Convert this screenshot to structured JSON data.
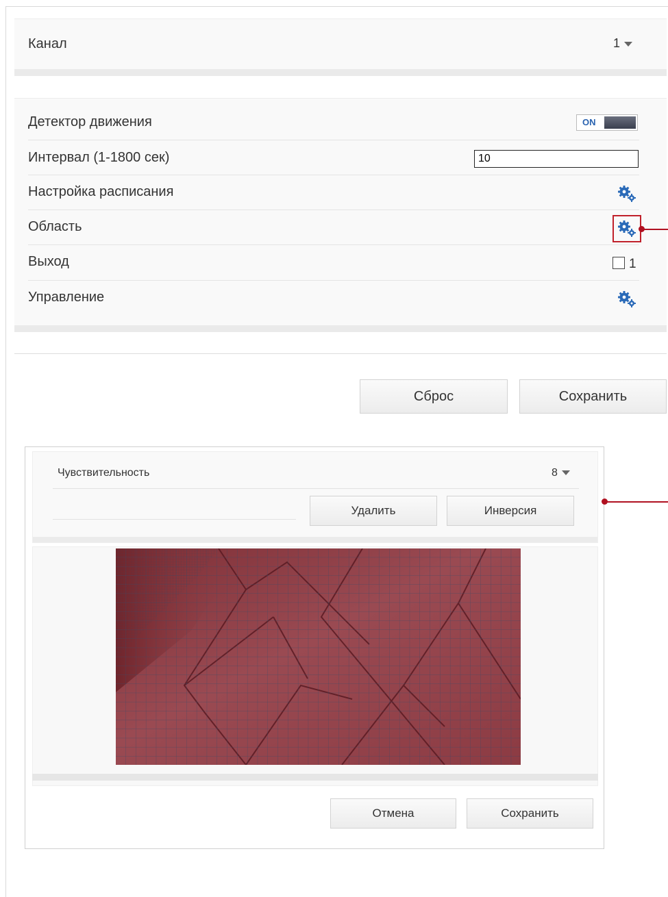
{
  "channel": {
    "label": "Канал",
    "value": "1"
  },
  "motion_settings": {
    "detector": {
      "label": "Детектор движения",
      "toggle_text": "ON",
      "enabled": true
    },
    "interval": {
      "label": "Интервал (1-1800 сек)",
      "value": "10"
    },
    "schedule": {
      "label": "Настройка расписания",
      "icon": "gear-icon"
    },
    "area": {
      "label": "Область",
      "icon": "gear-icon"
    },
    "output": {
      "label": "Выход",
      "checkbox_label": "1",
      "checked": false
    },
    "control": {
      "label": "Управление",
      "icon": "gear-icon"
    }
  },
  "actions": {
    "reset_label": "Сброс",
    "save_label": "Сохранить"
  },
  "area_dialog": {
    "sensitivity": {
      "label": "Чувствительность",
      "value": "8"
    },
    "delete_label": "Удалить",
    "invert_label": "Инверсия",
    "cancel_label": "Отмена",
    "save_label": "Сохранить"
  },
  "colors": {
    "accent_blue": "#2a6ab8",
    "callout_red": "#b01020",
    "mask_red": "#8a3a40"
  }
}
